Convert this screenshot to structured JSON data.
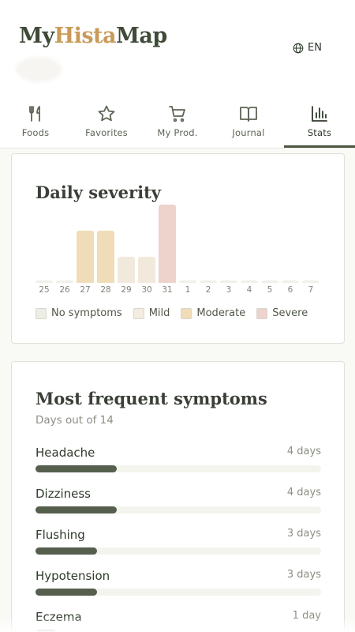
{
  "header": {
    "logo_my": "My",
    "logo_hista": "Hista",
    "logo_map": "Map",
    "language": "EN"
  },
  "tabs": [
    {
      "label": "Foods",
      "icon": "fork-knife-icon",
      "active": false
    },
    {
      "label": "Favorites",
      "icon": "star-icon",
      "active": false
    },
    {
      "label": "My Prod.",
      "icon": "cart-icon",
      "active": false
    },
    {
      "label": "Journal",
      "icon": "book-icon",
      "active": false
    },
    {
      "label": "Stats",
      "icon": "bar-chart-icon",
      "active": true
    }
  ],
  "severity": {
    "title": "Daily severity",
    "days": [
      {
        "label": "25",
        "level": "none"
      },
      {
        "label": "26",
        "level": "none"
      },
      {
        "label": "27",
        "level": "moderate"
      },
      {
        "label": "28",
        "level": "moderate"
      },
      {
        "label": "29",
        "level": "mild"
      },
      {
        "label": "30",
        "level": "mild"
      },
      {
        "label": "31",
        "level": "severe"
      },
      {
        "label": "1",
        "level": "none"
      },
      {
        "label": "2",
        "level": "none"
      },
      {
        "label": "3",
        "level": "none"
      },
      {
        "label": "4",
        "level": "none"
      },
      {
        "label": "5",
        "level": "none"
      },
      {
        "label": "6",
        "level": "none"
      },
      {
        "label": "7",
        "level": "none"
      }
    ],
    "levels": {
      "none": {
        "value": 0,
        "color": "#eef0e9"
      },
      "mild": {
        "value": 1,
        "color": "#f2e9dd"
      },
      "moderate": {
        "value": 2,
        "color": "#f0dcb6"
      },
      "severe": {
        "value": 3,
        "color": "#eed2cc"
      }
    },
    "legend": [
      {
        "label": "No symptoms",
        "color": "#eceee6"
      },
      {
        "label": "Mild",
        "color": "#f4ece0"
      },
      {
        "label": "Moderate",
        "color": "#f0dcb6"
      },
      {
        "label": "Severe",
        "color": "#eed2cc"
      }
    ]
  },
  "symptoms": {
    "title": "Most frequent symptoms",
    "subtitle": "Days out of 14",
    "total_days": 14,
    "items": [
      {
        "name": "Headache",
        "count_label": "4 days",
        "days": 4
      },
      {
        "name": "Dizziness",
        "count_label": "4 days",
        "days": 4
      },
      {
        "name": "Flushing",
        "count_label": "3 days",
        "days": 3
      },
      {
        "name": "Hypotension",
        "count_label": "3 days",
        "days": 3
      },
      {
        "name": "Eczema",
        "count_label": "1 day",
        "days": 1
      }
    ]
  }
}
